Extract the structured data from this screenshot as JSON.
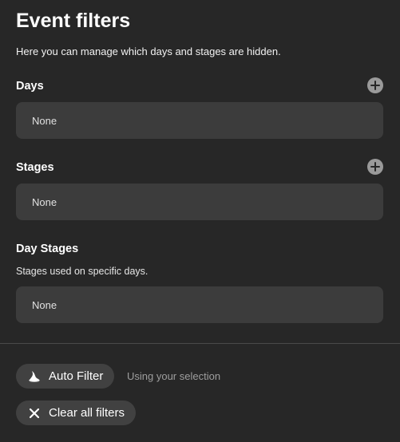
{
  "panel": {
    "title": "Event filters",
    "description": "Here you can manage which days and stages are hidden."
  },
  "sections": {
    "days": {
      "label": "Days",
      "value": "None",
      "add_icon": "plus-circle-icon"
    },
    "stages": {
      "label": "Stages",
      "value": "None",
      "add_icon": "plus-circle-icon"
    },
    "day_stages": {
      "label": "Day Stages",
      "description": "Stages used on specific days.",
      "value": "None"
    }
  },
  "actions": {
    "auto_filter": {
      "label": "Auto Filter",
      "hint": "Using your selection",
      "icon": "wizard-hat-icon"
    },
    "clear_filters": {
      "label": "Clear all filters",
      "icon": "close-icon"
    }
  },
  "colors": {
    "background": "#272727",
    "field": "#3c3c3c",
    "pill": "#414141",
    "muted_text": "#9e9e9e"
  }
}
